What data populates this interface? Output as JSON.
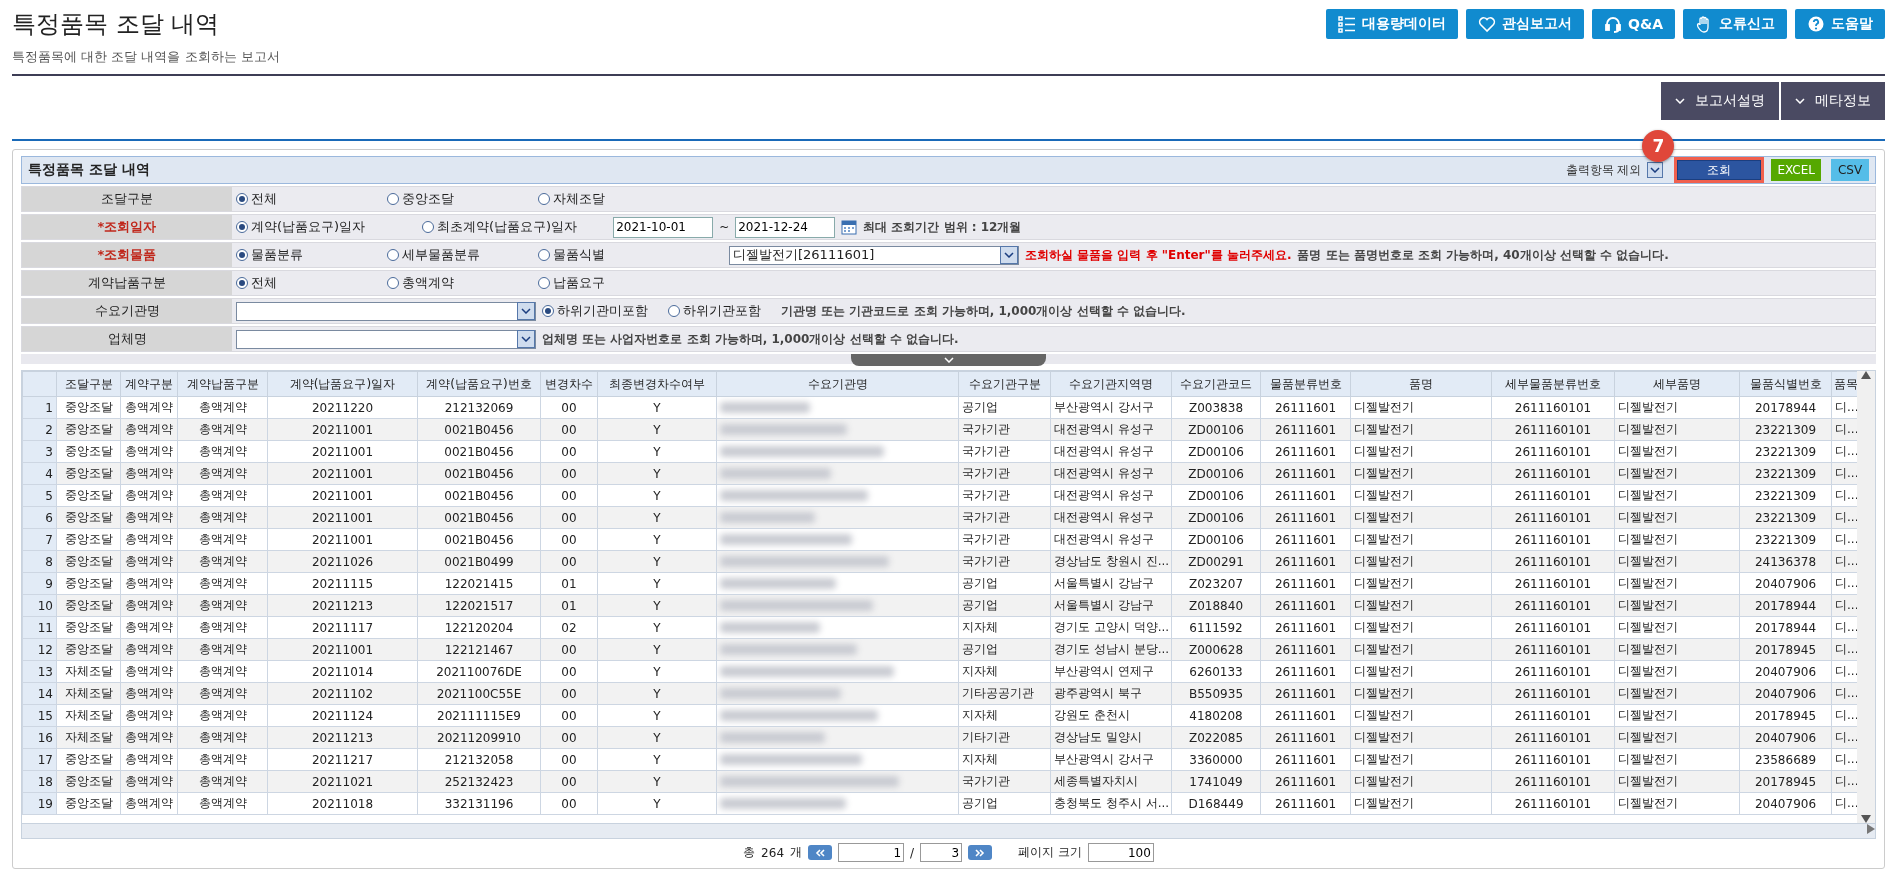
{
  "page": {
    "title": "특정품목 조달 내역",
    "subtitle": "특정품목에 대한 조달 내역을 조회하는 보고서"
  },
  "top_buttons": [
    {
      "kind": "list",
      "label": "대용량데이터"
    },
    {
      "kind": "heart",
      "label": "관심보고서"
    },
    {
      "kind": "headset",
      "label": "Q&A"
    },
    {
      "kind": "hand",
      "label": "오류신고"
    },
    {
      "kind": "help",
      "label": "도움말"
    }
  ],
  "info_buttons": [
    {
      "label": "보고서설명",
      "expanded": false
    },
    {
      "label": "메타정보",
      "expanded": false
    }
  ],
  "panel": {
    "title": "특정품목 조달 내역",
    "exclude_label": "출력항목 제외",
    "search_button": {
      "label": "조회",
      "highlighted": true,
      "step": "7"
    },
    "export_buttons": [
      {
        "kind": "excel",
        "label": "EXCEL"
      },
      {
        "kind": "csv",
        "label": "CSV"
      }
    ]
  },
  "filters": [
    {
      "label": "조달구분",
      "required": false,
      "items": [
        {
          "kind": "radio",
          "label": "전체",
          "selected": true
        },
        {
          "kind": "radio",
          "label": "중앙조달",
          "selected": false
        },
        {
          "kind": "radio",
          "label": "자체조달",
          "selected": false
        }
      ]
    },
    {
      "label": "*조회일자",
      "required": true,
      "items": [
        {
          "kind": "radio",
          "label": "계약(납품요구)일자",
          "selected": true
        },
        {
          "kind": "radio",
          "label": "최초계약(납품요구)일자",
          "selected": false
        },
        {
          "kind": "date",
          "value": "2021-10-01"
        },
        {
          "kind": "sep",
          "text": "~"
        },
        {
          "kind": "date",
          "value": "2021-12-24"
        },
        {
          "kind": "calendar"
        },
        {
          "kind": "note",
          "text": "최대 조회기간 범위 : 12개월"
        }
      ]
    },
    {
      "label": "*조회물품",
      "required": true,
      "items": [
        {
          "kind": "radio",
          "label": "물품분류",
          "selected": true
        },
        {
          "kind": "radio",
          "label": "세부물품분류",
          "selected": false
        },
        {
          "kind": "radio",
          "label": "물품식별",
          "selected": false
        },
        {
          "kind": "select",
          "value": "디젤발전기[26111601]"
        },
        {
          "kind": "warning",
          "text": "조회하실 물품을  입력 후 \"Enter\"를 눌러주세요."
        },
        {
          "kind": "note",
          "text": "품명 또는 품명번호로 조회 가능하며, 40개이상 선택할 수 없습니다."
        }
      ]
    },
    {
      "label": "계약납품구분",
      "required": false,
      "items": [
        {
          "kind": "radio",
          "label": "전체",
          "selected": true
        },
        {
          "kind": "radio",
          "label": "총액계약",
          "selected": false
        },
        {
          "kind": "radio",
          "label": "납품요구",
          "selected": false
        }
      ]
    },
    {
      "label": "수요기관명",
      "required": false,
      "items": [
        {
          "kind": "select",
          "value": ""
        },
        {
          "kind": "radio",
          "label": "하위기관미포함",
          "selected": true
        },
        {
          "kind": "radio",
          "label": "하위기관포함",
          "selected": false
        },
        {
          "kind": "note",
          "text": "기관명 또는 기관코드로 조회 가능하며, 1,000개이상 선택할 수 없습니다."
        }
      ]
    },
    {
      "label": "업체명",
      "required": false,
      "items": [
        {
          "kind": "select",
          "value": ""
        },
        {
          "kind": "note",
          "text": "업체명 또는 사업자번호로 조회 가능하며, 1,000개이상 선택할 수 없습니다."
        }
      ]
    }
  ],
  "table": {
    "columns": [
      {
        "kind": "index"
      },
      {
        "label": "조달구분",
        "kind": "text"
      },
      {
        "label": "계약구분",
        "kind": "text"
      },
      {
        "label": "계약납품구분",
        "kind": "text"
      },
      {
        "label": "계약(납품요구)일자",
        "kind": "text"
      },
      {
        "label": "계약(납품요구)번호",
        "kind": "text"
      },
      {
        "label": "변경차수",
        "kind": "text"
      },
      {
        "label": "최종변경차수여부",
        "kind": "text"
      },
      {
        "label": "수요기관명",
        "kind": "blurred"
      },
      {
        "label": "수요기관구분",
        "kind": "text"
      },
      {
        "label": "수요기관지역명",
        "kind": "text"
      },
      {
        "label": "수요기관코드",
        "kind": "text"
      },
      {
        "label": "물품분류번호",
        "kind": "text"
      },
      {
        "label": "품명",
        "kind": "text"
      },
      {
        "label": "세부물품분류번호",
        "kind": "text"
      },
      {
        "label": "세부품명",
        "kind": "text"
      },
      {
        "label": "물품식별번호",
        "kind": "text"
      },
      {
        "label": "품목",
        "kind": "text"
      }
    ],
    "rows": [
      [
        "1",
        "중앙조달",
        "총액계약",
        "총액계약",
        "20211220",
        "212132069",
        "00",
        "Y",
        "",
        "공기업",
        "부산광역시 강서구",
        "Z003838",
        "26111601",
        "디젤발전기",
        "2611160101",
        "디젤발전기",
        "20178944",
        "디..."
      ],
      [
        "2",
        "중앙조달",
        "총액계약",
        "총액계약",
        "20211001",
        "0021B0456",
        "00",
        "Y",
        "",
        "국가기관",
        "대전광역시 유성구",
        "ZD00106",
        "26111601",
        "디젤발전기",
        "2611160101",
        "디젤발전기",
        "23221309",
        "디..."
      ],
      [
        "3",
        "중앙조달",
        "총액계약",
        "총액계약",
        "20211001",
        "0021B0456",
        "00",
        "Y",
        "",
        "국가기관",
        "대전광역시 유성구",
        "ZD00106",
        "26111601",
        "디젤발전기",
        "2611160101",
        "디젤발전기",
        "23221309",
        "디..."
      ],
      [
        "4",
        "중앙조달",
        "총액계약",
        "총액계약",
        "20211001",
        "0021B0456",
        "00",
        "Y",
        "",
        "국가기관",
        "대전광역시 유성구",
        "ZD00106",
        "26111601",
        "디젤발전기",
        "2611160101",
        "디젤발전기",
        "23221309",
        "디..."
      ],
      [
        "5",
        "중앙조달",
        "총액계약",
        "총액계약",
        "20211001",
        "0021B0456",
        "00",
        "Y",
        "",
        "국가기관",
        "대전광역시 유성구",
        "ZD00106",
        "26111601",
        "디젤발전기",
        "2611160101",
        "디젤발전기",
        "23221309",
        "디..."
      ],
      [
        "6",
        "중앙조달",
        "총액계약",
        "총액계약",
        "20211001",
        "0021B0456",
        "00",
        "Y",
        "",
        "국가기관",
        "대전광역시 유성구",
        "ZD00106",
        "26111601",
        "디젤발전기",
        "2611160101",
        "디젤발전기",
        "23221309",
        "디..."
      ],
      [
        "7",
        "중앙조달",
        "총액계약",
        "총액계약",
        "20211001",
        "0021B0456",
        "00",
        "Y",
        "",
        "국가기관",
        "대전광역시 유성구",
        "ZD00106",
        "26111601",
        "디젤발전기",
        "2611160101",
        "디젤발전기",
        "23221309",
        "디..."
      ],
      [
        "8",
        "중앙조달",
        "총액계약",
        "총액계약",
        "20211026",
        "0021B0499",
        "00",
        "Y",
        "",
        "국가기관",
        "경상남도 창원시 진...",
        "ZD00291",
        "26111601",
        "디젤발전기",
        "2611160101",
        "디젤발전기",
        "24136378",
        "디..."
      ],
      [
        "9",
        "중앙조달",
        "총액계약",
        "총액계약",
        "20211115",
        "122021415",
        "01",
        "Y",
        "",
        "공기업",
        "서울특별시 강남구",
        "Z023207",
        "26111601",
        "디젤발전기",
        "2611160101",
        "디젤발전기",
        "20407906",
        "디..."
      ],
      [
        "10",
        "중앙조달",
        "총액계약",
        "총액계약",
        "20211213",
        "122021517",
        "01",
        "Y",
        "",
        "공기업",
        "서울특별시 강남구",
        "Z018840",
        "26111601",
        "디젤발전기",
        "2611160101",
        "디젤발전기",
        "20178944",
        "디..."
      ],
      [
        "11",
        "중앙조달",
        "총액계약",
        "총액계약",
        "20211117",
        "122120204",
        "02",
        "Y",
        "",
        "지자체",
        "경기도 고양시 덕양...",
        "6111592",
        "26111601",
        "디젤발전기",
        "2611160101",
        "디젤발전기",
        "20178944",
        "디..."
      ],
      [
        "12",
        "중앙조달",
        "총액계약",
        "총액계약",
        "20211001",
        "122121467",
        "00",
        "Y",
        "",
        "공기업",
        "경기도 성남시 분당...",
        "Z000628",
        "26111601",
        "디젤발전기",
        "2611160101",
        "디젤발전기",
        "20178945",
        "디..."
      ],
      [
        "13",
        "자체조달",
        "총액계약",
        "총액계약",
        "20211014",
        "202110076DE",
        "00",
        "Y",
        "",
        "지자체",
        "부산광역시 연제구",
        "6260133",
        "26111601",
        "디젤발전기",
        "2611160101",
        "디젤발전기",
        "20407906",
        "디..."
      ],
      [
        "14",
        "자체조달",
        "총액계약",
        "총액계약",
        "20211102",
        "2021100C55E",
        "00",
        "Y",
        "",
        "기타공공기관",
        "광주광역시 북구",
        "B550935",
        "26111601",
        "디젤발전기",
        "2611160101",
        "디젤발전기",
        "20407906",
        "디..."
      ],
      [
        "15",
        "자체조달",
        "총액계약",
        "총액계약",
        "20211124",
        "202111115E9",
        "00",
        "Y",
        "",
        "지자체",
        "강원도 춘천시",
        "4180208",
        "26111601",
        "디젤발전기",
        "2611160101",
        "디젤발전기",
        "20178945",
        "디..."
      ],
      [
        "16",
        "자체조달",
        "총액계약",
        "총액계약",
        "20211213",
        "20211209910",
        "00",
        "Y",
        "",
        "기타기관",
        "경상남도 밀양시",
        "Z022085",
        "26111601",
        "디젤발전기",
        "2611160101",
        "디젤발전기",
        "20407906",
        "디..."
      ],
      [
        "17",
        "중앙조달",
        "총액계약",
        "총액계약",
        "20211217",
        "212132058",
        "00",
        "Y",
        "",
        "지자체",
        "부산광역시 강서구",
        "3360000",
        "26111601",
        "디젤발전기",
        "2611160101",
        "디젤발전기",
        "23586689",
        "디..."
      ],
      [
        "18",
        "중앙조달",
        "총액계약",
        "총액계약",
        "20211021",
        "252132423",
        "00",
        "Y",
        "",
        "국가기관",
        "세종특별자치시",
        "1741049",
        "26111601",
        "디젤발전기",
        "2611160101",
        "디젤발전기",
        "20178945",
        "디..."
      ],
      [
        "19",
        "중앙조달",
        "총액계약",
        "총액계약",
        "20211018",
        "332131196",
        "00",
        "Y",
        "",
        "공기업",
        "충청북도 청주시 서...",
        "D168449",
        "26111601",
        "디젤발전기",
        "2611160101",
        "디젤발전기",
        "20407906",
        "디..."
      ]
    ]
  },
  "pager": {
    "total_prefix": "총",
    "total": "264",
    "total_suffix": "개",
    "page": "1",
    "sep": "/",
    "pages": "3",
    "size_label": "페이지 크기",
    "size": "100"
  }
}
